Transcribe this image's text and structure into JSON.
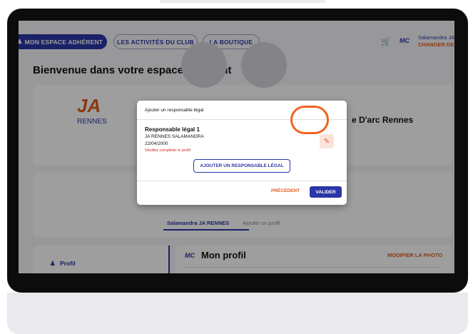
{
  "nav": {
    "tabs": [
      "MON ESPACE ADHÉRENT",
      "LES ACTIVITÉS DU CLUB",
      "LA BOUTIQUE"
    ],
    "logo": "MC",
    "user_name": "Salamandra JA",
    "user_action": "CHANGER DE P"
  },
  "page": {
    "title": "Bienvenue dans votre espace adhérent",
    "club_logo_text": "JA",
    "club_logo_sub": "RENNES",
    "club_name": "e D'arc Rennes"
  },
  "member_tabs": [
    "Salamandra JA RENNES",
    "Ajouter un profil"
  ],
  "sidebar": {
    "items": [
      {
        "label": "Profil"
      }
    ]
  },
  "profile": {
    "logo": "MC",
    "title": "Mon profil",
    "photo_action": "MODIFIER LA PHOTO"
  },
  "modal": {
    "title": "Ajouter un responsable légal",
    "guardian_title": "Responsable légal 1",
    "guardian_club": "JA RENNES SALAMANDRA",
    "guardian_date": "22/04/2000",
    "warning": "Veuillez compléter le profil",
    "add_button": "AJOUTER UN RESPONSABLE LÉGAL",
    "prev_button": "PRÉCÉDENT",
    "validate_button": "VALIDER"
  },
  "colors": {
    "brand_blue": "#2b36a8",
    "accent_orange": "#e05d1f",
    "highlight_ring": "#f26322"
  },
  "icons": [
    "cart-icon",
    "person-icon",
    "pencil-icon"
  ]
}
